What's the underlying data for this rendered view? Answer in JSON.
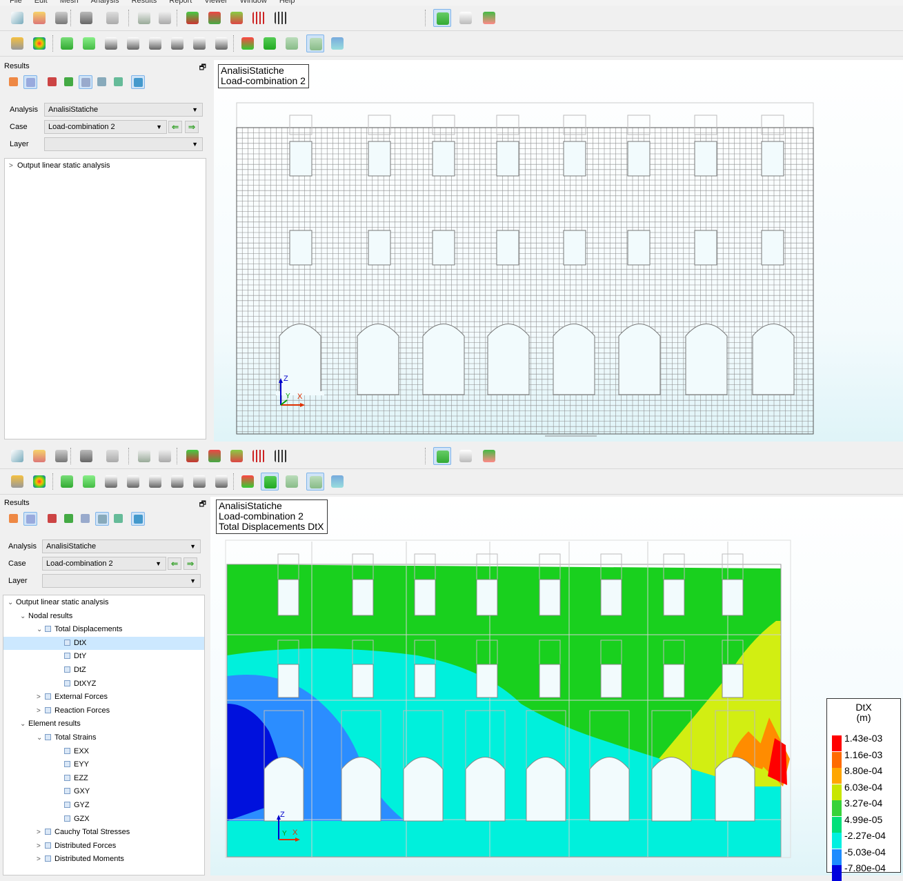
{
  "menu": [
    "File",
    "Edit",
    "Mesh",
    "Analysis",
    "Results",
    "Report",
    "Viewer",
    "Window",
    "Help"
  ],
  "panel_top": {
    "title": "Results",
    "analysis_label": "Analysis",
    "analysis_value": "AnalisiStatiche",
    "case_label": "Case",
    "case_value": "Load-combination 2",
    "layer_label": "Layer",
    "layer_value": "",
    "tree": [
      "Output linear static analysis"
    ]
  },
  "panel_bottom": {
    "title": "Results",
    "analysis_label": "Analysis",
    "analysis_value": "AnalisiStatiche",
    "case_label": "Case",
    "case_value": "Load-combination 2",
    "layer_label": "Layer",
    "layer_value": "",
    "tree": [
      {
        "label": "Output linear static analysis",
        "level": 0,
        "exp": "open",
        "chk": false
      },
      {
        "label": "Nodal results",
        "level": 1,
        "exp": "open",
        "chk": false
      },
      {
        "label": "Total Displacements",
        "level": 2,
        "exp": "open",
        "chk": true
      },
      {
        "label": "DtX",
        "level": 3,
        "exp": "",
        "chk": true,
        "sel": true
      },
      {
        "label": "DtY",
        "level": 3,
        "exp": "",
        "chk": true
      },
      {
        "label": "DtZ",
        "level": 3,
        "exp": "",
        "chk": true
      },
      {
        "label": "DtXYZ",
        "level": 3,
        "exp": "",
        "chk": true
      },
      {
        "label": "External Forces",
        "level": 2,
        "exp": "closed",
        "chk": true
      },
      {
        "label": "Reaction Forces",
        "level": 2,
        "exp": "closed",
        "chk": true
      },
      {
        "label": "Element results",
        "level": 1,
        "exp": "open",
        "chk": false
      },
      {
        "label": "Total Strains",
        "level": 2,
        "exp": "open",
        "chk": true
      },
      {
        "label": "EXX",
        "level": 3,
        "exp": "",
        "chk": true
      },
      {
        "label": "EYY",
        "level": 3,
        "exp": "",
        "chk": true
      },
      {
        "label": "EZZ",
        "level": 3,
        "exp": "",
        "chk": true
      },
      {
        "label": "GXY",
        "level": 3,
        "exp": "",
        "chk": true
      },
      {
        "label": "GYZ",
        "level": 3,
        "exp": "",
        "chk": true
      },
      {
        "label": "GZX",
        "level": 3,
        "exp": "",
        "chk": true
      },
      {
        "label": "Cauchy Total Stresses",
        "level": 2,
        "exp": "closed",
        "chk": true
      },
      {
        "label": "Distributed Forces",
        "level": 2,
        "exp": "closed",
        "chk": true
      },
      {
        "label": "Distributed Moments",
        "level": 2,
        "exp": "closed",
        "chk": true
      }
    ]
  },
  "view_top": {
    "title_line1": "AnalisiStatiche",
    "title_line2": "Load-combination 2",
    "axes": {
      "z": "Z",
      "y": "Y",
      "x": "X"
    }
  },
  "view_bottom": {
    "title_line1": "AnalisiStatiche",
    "title_line2": "Load-combination 2",
    "title_line3": "Total Displacements DtX",
    "axes": {
      "z": "Z",
      "y": "Y",
      "x": "X"
    }
  },
  "legend": {
    "title": "DtX",
    "unit": "(m)",
    "entries": [
      {
        "value": "1.43e-03",
        "color": "#ff0000"
      },
      {
        "value": "1.16e-03",
        "color": "#ff6a00"
      },
      {
        "value": "8.80e-04",
        "color": "#ffa600"
      },
      {
        "value": "6.03e-04",
        "color": "#c8e600"
      },
      {
        "value": "3.27e-04",
        "color": "#37d23a"
      },
      {
        "value": "4.99e-05",
        "color": "#00e07a"
      },
      {
        "value": "-2.27e-04",
        "color": "#00f0e0"
      },
      {
        "value": "-5.03e-04",
        "color": "#1e8cff"
      },
      {
        "value": "-7.80e-04",
        "color": "#0000dd"
      }
    ]
  },
  "contour_colors": {
    "green": "#19d01e",
    "green_light": "#2fdc24",
    "yellow": "#d2ee12",
    "orange": "#ff8c00",
    "red": "#ff0000",
    "cyan": "#00f0dc",
    "blue": "#2b8dff",
    "darkblue": "#0011dd"
  }
}
